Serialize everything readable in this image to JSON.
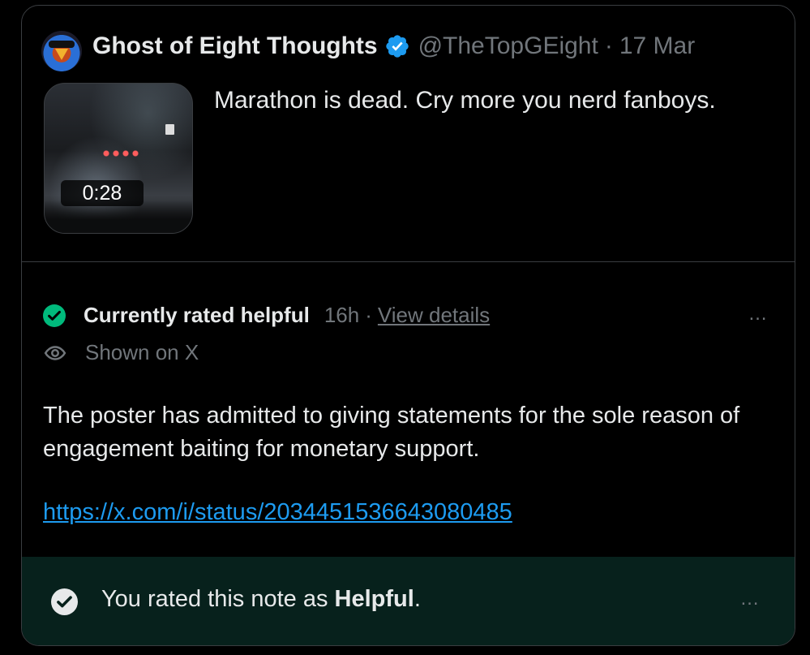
{
  "tweet": {
    "author_name": "Ghost of Eight Thoughts",
    "handle": "@TheTopGEight",
    "separator": "·",
    "date": "17 Mar",
    "text": "Marathon is dead. Cry more you nerd fanboys.",
    "media": {
      "duration": "0:28"
    }
  },
  "note": {
    "status_label": "Currently rated helpful",
    "status_time": "16h",
    "separator": "·",
    "view_details": "View details",
    "shown_label": "Shown on X",
    "body": "The poster has admitted to giving statements for the sole reason of engagement baiting for monetary support.",
    "link": "https://x.com/i/status/2034451536643080485",
    "more_icon": "…"
  },
  "rating": {
    "prefix": "You rated this note as ",
    "value": "Helpful",
    "suffix": ".",
    "more_icon": "…"
  },
  "colors": {
    "background": "#000000",
    "text": "#e7e9ea",
    "muted": "#71767b",
    "link": "#1d9bf0",
    "verified": "#1d9bf0",
    "helpful_green": "#00ba7c",
    "rated_bar": "#07211c"
  },
  "icons": {
    "verified": "verified-badge-icon",
    "status": "check-circle-icon",
    "shown": "eye-icon",
    "rated": "check-circle-icon",
    "more": "more-horizontal-icon"
  }
}
